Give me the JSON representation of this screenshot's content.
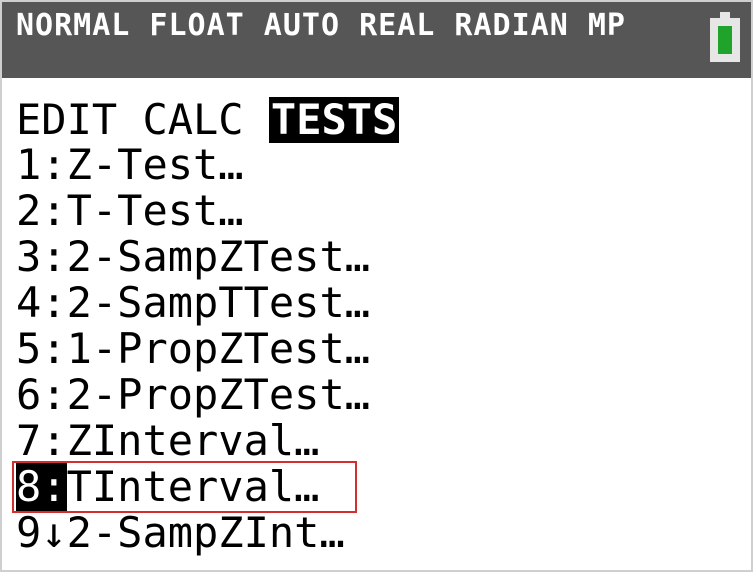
{
  "status": {
    "text": "NORMAL FLOAT AUTO REAL RADIAN MP"
  },
  "menu": {
    "tabs": [
      {
        "label": "EDIT"
      },
      {
        "label": "CALC"
      },
      {
        "label": "TESTS"
      }
    ],
    "active_tab": "TESTS"
  },
  "items": [
    {
      "num": "1",
      "sep": ":",
      "label": "Z-Test…"
    },
    {
      "num": "2",
      "sep": ":",
      "label": "T-Test…"
    },
    {
      "num": "3",
      "sep": ":",
      "label": "2-SampZTest…"
    },
    {
      "num": "4",
      "sep": ":",
      "label": "2-SampTTest…"
    },
    {
      "num": "5",
      "sep": ":",
      "label": "1-PropZTest…"
    },
    {
      "num": "6",
      "sep": ":",
      "label": "2-PropZTest…"
    },
    {
      "num": "7",
      "sep": ":",
      "label": "ZInterval…"
    },
    {
      "num": "8",
      "sep": ":",
      "label": "TInterval…"
    },
    {
      "num": "9",
      "sep": "↓",
      "label": "2-SampZInt…"
    }
  ],
  "selected_item": "8",
  "colors": {
    "status_bar": "#565656",
    "battery_green": "#1fa32a",
    "highlight_box": "#d32f2f"
  },
  "icons": {
    "battery": "battery-icon"
  }
}
